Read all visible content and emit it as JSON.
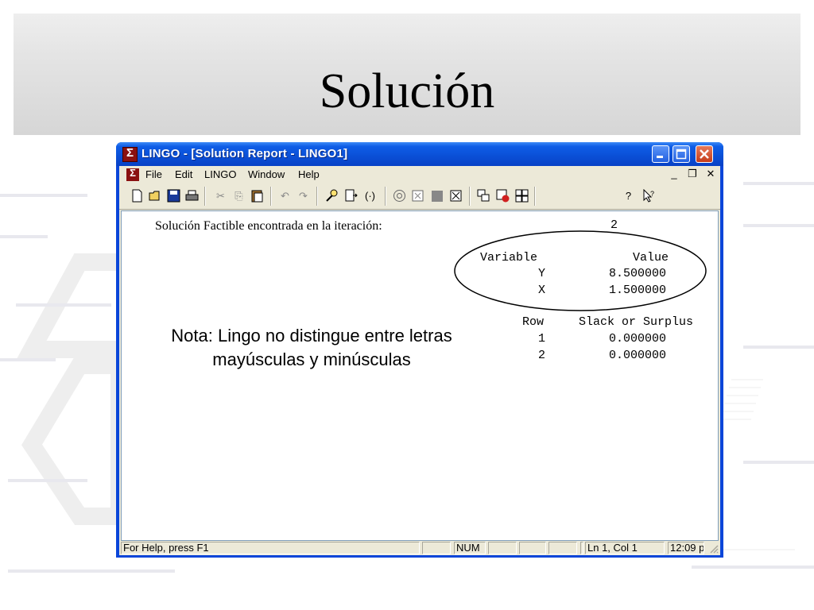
{
  "slide": {
    "title": "Solución"
  },
  "window": {
    "title": "LINGO - [Solution Report - LINGO1]",
    "menu": [
      "File",
      "Edit",
      "LINGO",
      "Window",
      "Help"
    ]
  },
  "report": {
    "feasible_label": "Solución Factible encontrada en la iteración:",
    "iteration": "2",
    "variables_header": {
      "name": "Variable",
      "value": "Value"
    },
    "variables": [
      {
        "name": "Y",
        "value": "8.500000"
      },
      {
        "name": "X",
        "value": "1.500000"
      }
    ],
    "rows_header": {
      "row": "Row",
      "slack": "Slack or Surplus"
    },
    "rows": [
      {
        "row": "1",
        "slack": "0.000000"
      },
      {
        "row": "2",
        "slack": "0.000000"
      }
    ],
    "note_line1": "Nota: Lingo no distingue entre letras",
    "note_line2": "mayúsculas y minúsculas"
  },
  "status": {
    "help": "For Help, press F1",
    "num": "NUM",
    "position": "Ln 1, Col 1",
    "time": "12:09 p"
  },
  "colors": {
    "titlebar": "#0a4fd6",
    "chrome": "#ece9d8",
    "close_button": "#c53c1a"
  }
}
